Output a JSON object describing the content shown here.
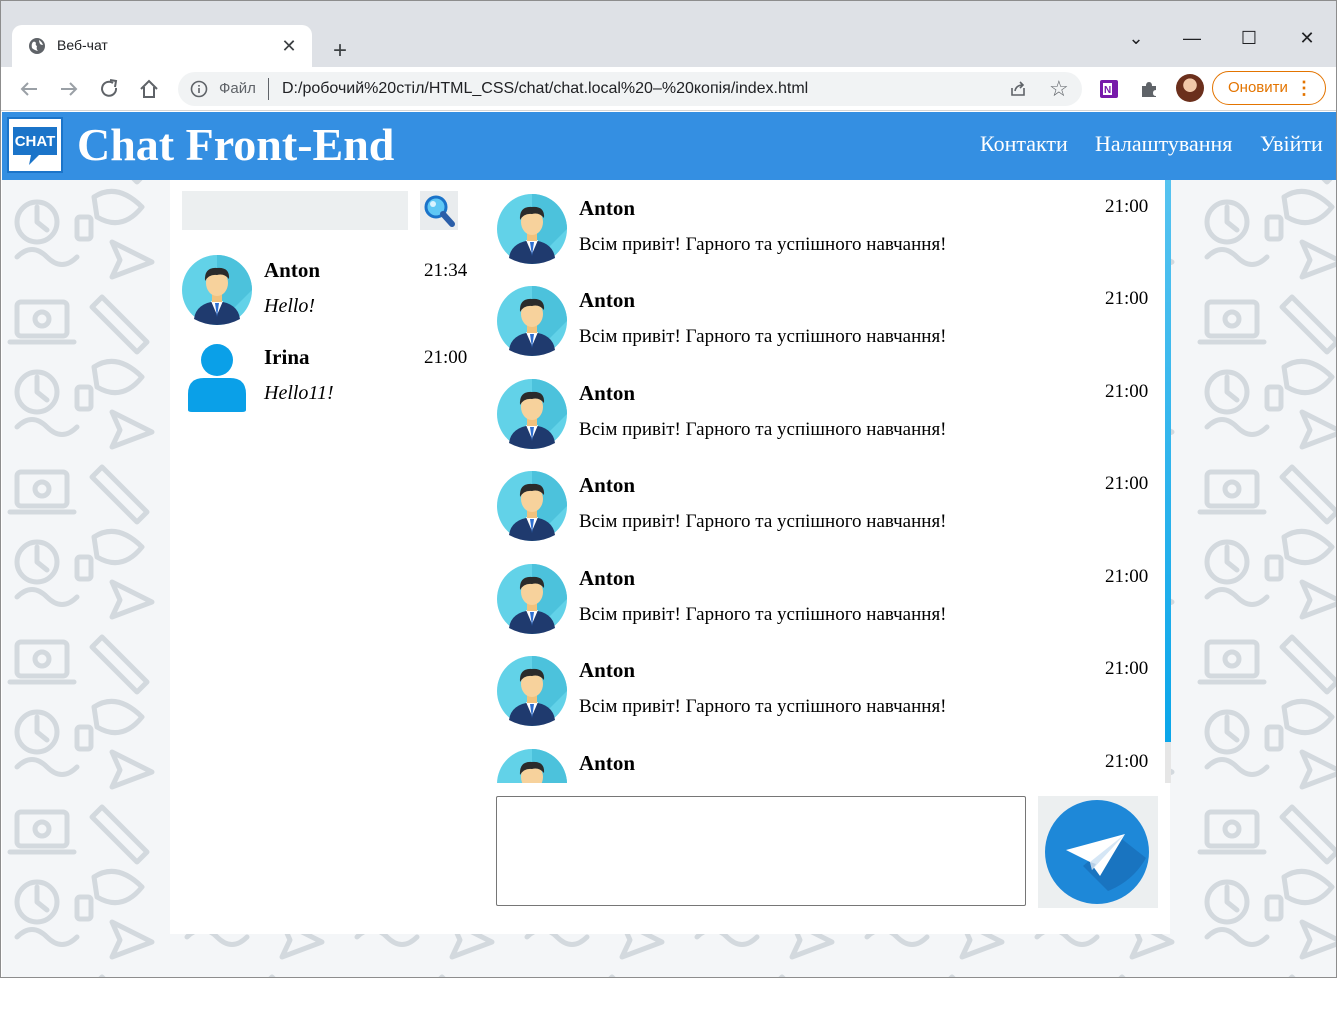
{
  "browser": {
    "tab_title": "Веб-чат",
    "tab_close": "✕",
    "new_tab": "+",
    "address_scheme": "Файл",
    "address_url": "D:/робочий%20стіл/HTML_CSS/chat/chat.local%20–%20копія/index.html",
    "update_button": "Оновити",
    "update_menu": "⋮",
    "window_controls": [
      "⌄",
      "—",
      "☐",
      "✕"
    ]
  },
  "header": {
    "logo_text": "CHAT",
    "title": "Chat Front-End",
    "nav": [
      "Контакти",
      "Налаштування",
      "Увійти"
    ]
  },
  "search": {
    "placeholder": ""
  },
  "contacts": [
    {
      "name": "Anton",
      "time": "21:34",
      "last_message": "Hello!",
      "avatar": "man-avatar-icon"
    },
    {
      "name": "Irina",
      "time": "21:00",
      "last_message": "Hello11!",
      "avatar": "user-silhouette-icon"
    }
  ],
  "messages": [
    {
      "author": "Anton",
      "time": "21:00",
      "text": "Всім привіт! Гарного та успішного навчання!"
    },
    {
      "author": "Anton",
      "time": "21:00",
      "text": "Всім привіт! Гарного та успішного навчання!"
    },
    {
      "author": "Anton",
      "time": "21:00",
      "text": "Всім привіт! Гарного та успішного навчання!"
    },
    {
      "author": "Anton",
      "time": "21:00",
      "text": "Всім привіт! Гарного та успішного навчання!"
    },
    {
      "author": "Anton",
      "time": "21:00",
      "text": "Всім привіт! Гарного та успішного навчання!"
    },
    {
      "author": "Anton",
      "time": "21:00",
      "text": "Всім привіт! Гарного та успішного навчання!"
    },
    {
      "author": "Anton",
      "time": "21:00",
      "text": ""
    }
  ],
  "composer": {
    "placeholder": ""
  },
  "colors": {
    "header_bg": "#348fe2",
    "accent": "#1e88d8",
    "update_button": "#e37400"
  }
}
